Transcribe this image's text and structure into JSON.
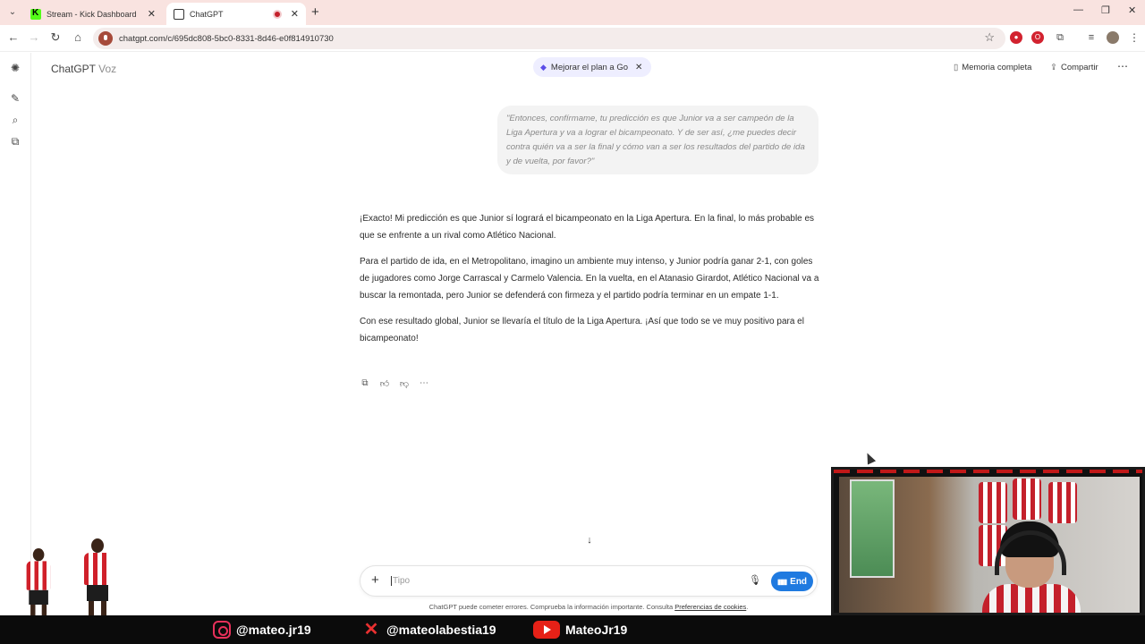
{
  "browser": {
    "tabs": [
      {
        "title": "Stream - Kick Dashboard",
        "active": false
      },
      {
        "title": "ChatGPT",
        "active": true
      }
    ],
    "url": "chatgpt.com/c/695dc808-5bc0-8331-8d46-e0f814910730"
  },
  "app": {
    "title": "ChatGPT",
    "mode": "Voz",
    "upgrade_label": "Mejorar el plan a Go",
    "memory_label": "Memoria completa",
    "share_label": "Compartir"
  },
  "conversation": {
    "user_message": "\"Entonces, confírmame, tu predicción es que Junior va a ser campeón de la Liga Apertura y va a lograr el bicampeonato. Y de ser así, ¿me puedes decir contra quién va a ser la final y cómo van a ser los resultados del partido de ida y de vuelta, por favor?\"",
    "assistant_paragraphs": [
      "¡Exacto! Mi predicción es que Junior sí logrará el bicampeonato en la Liga Apertura. En la final, lo más probable es que se enfrente a un rival como Atlético Nacional.",
      "Para el partido de ida, en el Metropolitano, imagino un ambiente muy intenso, y Junior podría ganar 2-1, con goles de jugadores como Jorge Carrascal y Carmelo Valencia. En la vuelta, en el Atanasio Girardot, Atlético Nacional va a buscar la remontada, pero Junior se defenderá con firmeza y el partido podría terminar en un empate 1-1.",
      "Con ese resultado global, Junior se llevaría el título de la Liga Apertura. ¡Así que todo se ve muy positivo para el bicampeonato!"
    ]
  },
  "composer": {
    "placeholder": "Tipo",
    "end_label": "End"
  },
  "disclaimer": {
    "text": "ChatGPT puede cometer errores. Comprueba la información importante. Consulta ",
    "link": "Preferencias de cookies",
    "suffix": "."
  },
  "stream_overlay": {
    "instagram": "@mateo.jr19",
    "x": "@mateolabestia19",
    "youtube": "MateoJr19",
    "accent_color": "#c4202b"
  }
}
